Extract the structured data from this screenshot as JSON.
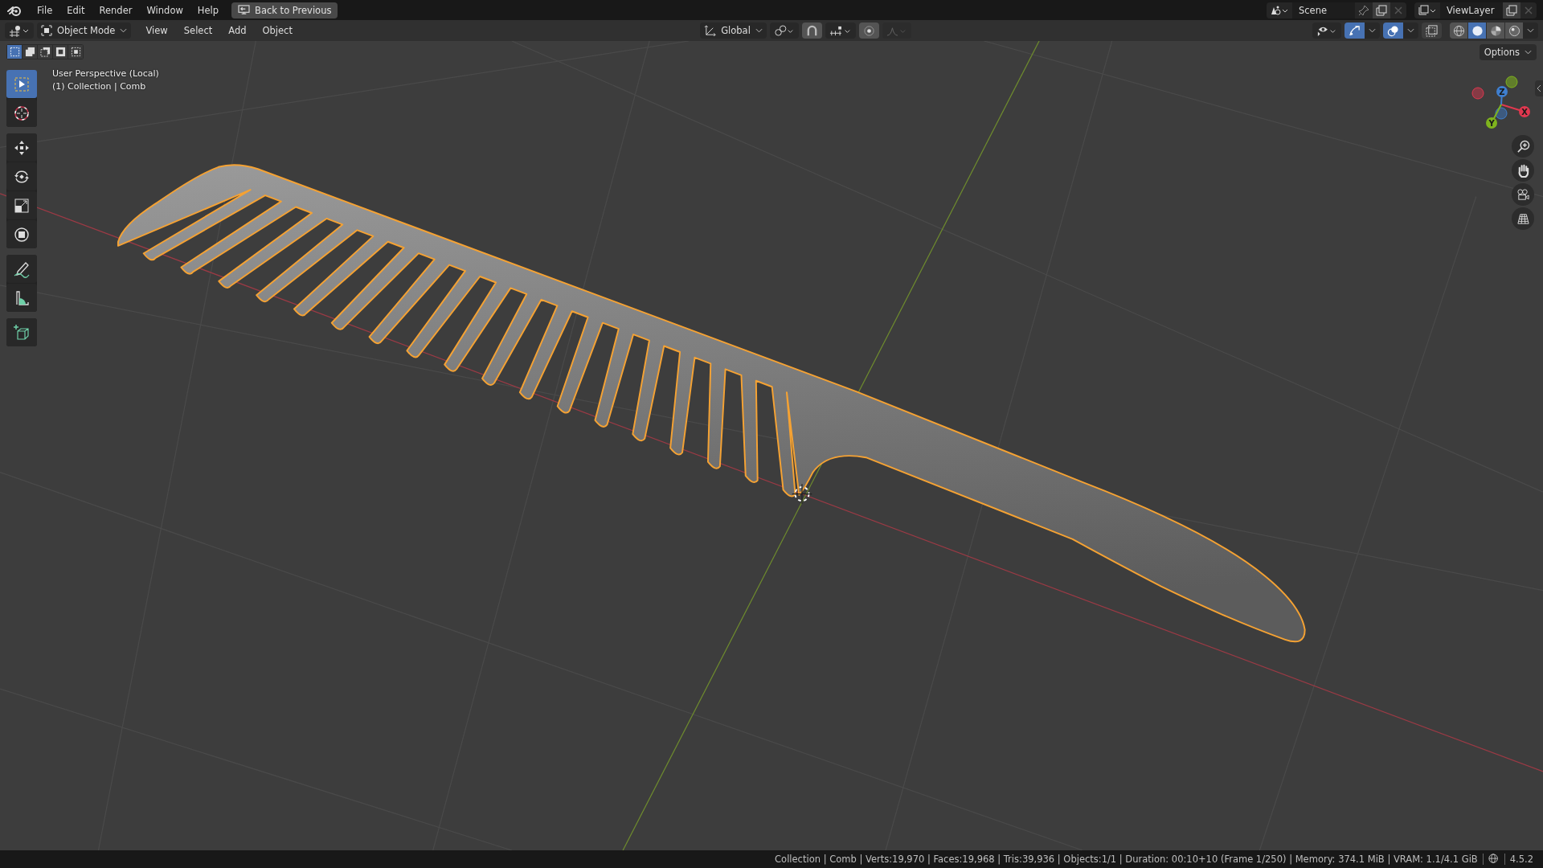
{
  "top_bar": {
    "menus": [
      "File",
      "Edit",
      "Render",
      "Window",
      "Help"
    ],
    "back_button": "Back to Previous",
    "scene": "Scene",
    "view_layer": "ViewLayer"
  },
  "header": {
    "mode": "Object Mode",
    "menus": [
      "View",
      "Select",
      "Add",
      "Object"
    ],
    "orientation": "Global",
    "toggles": [
      {
        "kind": "gizmo",
        "on": true
      },
      {
        "kind": "overlay",
        "on": true
      },
      {
        "kind": "xray",
        "on": false
      }
    ],
    "shading": [
      {
        "kind": "wireframe",
        "selected": false
      },
      {
        "kind": "solid",
        "selected": true
      },
      {
        "kind": "material",
        "selected": false
      },
      {
        "kind": "rendered",
        "selected": false
      }
    ]
  },
  "select_modes": [
    {
      "kind": "new",
      "selected": true
    },
    {
      "kind": "extend",
      "selected": false
    },
    {
      "kind": "subtract",
      "selected": false
    },
    {
      "kind": "invert",
      "selected": false
    },
    {
      "kind": "intersect",
      "selected": false
    }
  ],
  "viewport": {
    "perspective": "User Perspective (Local)",
    "object_info": "(1) Collection | Comb",
    "options": "Options"
  },
  "tool_groups": [
    [
      {
        "kind": "select",
        "selected": true
      },
      {
        "kind": "cursor",
        "selected": false
      }
    ],
    [
      {
        "kind": "move",
        "selected": false
      },
      {
        "kind": "rotate",
        "selected": false
      },
      {
        "kind": "scale",
        "selected": false
      },
      {
        "kind": "transform",
        "selected": false
      }
    ],
    [
      {
        "kind": "annotate",
        "selected": false
      },
      {
        "kind": "measure",
        "selected": false
      }
    ],
    [
      {
        "kind": "add_cube",
        "selected": false
      }
    ]
  ],
  "nav_gizmo": {
    "axes": [
      {
        "label": "X",
        "color": "#e0384f"
      },
      {
        "label": "Y",
        "color": "#7fb41d"
      },
      {
        "label": "Z",
        "color": "#3f7fd0"
      }
    ]
  },
  "status_bar": {
    "stats": "Collection | Comb | Verts:19,970 | Faces:19,968 | Tris:39,936 | Objects:1/1 | Duration: 00:10+10 (Frame 1/250) | Memory: 374.1 MiB | VRAM: 1.1/4.1 GiB",
    "version": "4.5.2"
  }
}
